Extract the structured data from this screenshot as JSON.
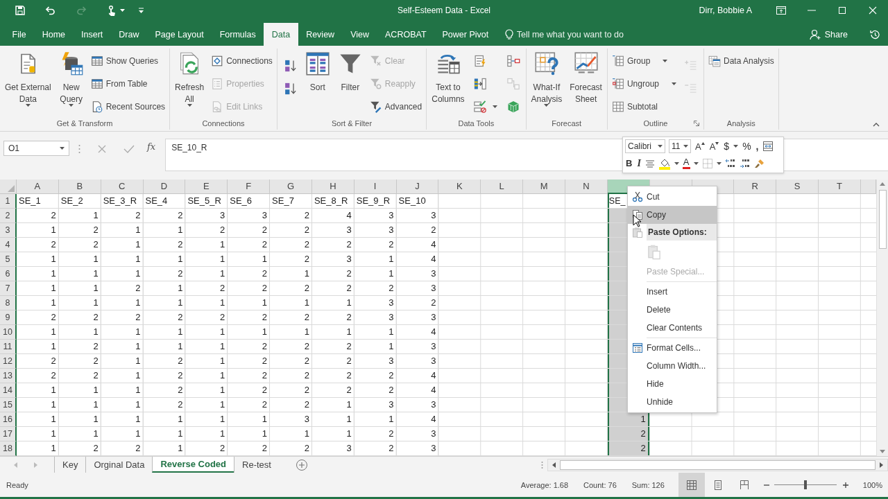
{
  "window": {
    "title": "Self-Esteem Data  -  Excel",
    "user": "Dirr, Bobbie A"
  },
  "ribbon_tabs": [
    {
      "label": "File",
      "selected": false
    },
    {
      "label": "Home",
      "selected": false
    },
    {
      "label": "Insert",
      "selected": false
    },
    {
      "label": "Draw",
      "selected": false
    },
    {
      "label": "Page Layout",
      "selected": false
    },
    {
      "label": "Formulas",
      "selected": false
    },
    {
      "label": "Data",
      "selected": true
    },
    {
      "label": "Review",
      "selected": false
    },
    {
      "label": "View",
      "selected": false
    },
    {
      "label": "ACROBAT",
      "selected": false
    },
    {
      "label": "Power Pivot",
      "selected": false
    }
  ],
  "tell_me": {
    "placeholder": "Tell me what you want to do"
  },
  "share": "Share",
  "ribbon_groups": [
    {
      "label": "Get & Transform",
      "launcher": false,
      "columns": [
        [
          {
            "kind": "large",
            "lines": [
              "Get External",
              "Data"
            ],
            "dropdown": true,
            "disabled": false
          }
        ],
        [
          {
            "kind": "large",
            "lines": [
              "New",
              "Query"
            ],
            "dropdown": true,
            "disabled": false
          }
        ],
        [
          {
            "kind": "small",
            "label": "Show Queries",
            "dropdown": false,
            "disabled": false
          },
          {
            "kind": "small",
            "label": "From Table",
            "dropdown": false,
            "disabled": false
          },
          {
            "kind": "small",
            "label": "Recent Sources",
            "dropdown": false,
            "disabled": false
          }
        ]
      ]
    },
    {
      "label": "Connections",
      "launcher": false,
      "columns": [
        [
          {
            "kind": "large",
            "lines": [
              "Refresh",
              "All"
            ],
            "dropdown": true,
            "disabled": false
          }
        ],
        [
          {
            "kind": "small",
            "label": "Connections",
            "dropdown": false,
            "disabled": false
          },
          {
            "kind": "small",
            "label": "Properties",
            "dropdown": false,
            "disabled": true
          },
          {
            "kind": "small",
            "label": "Edit Links",
            "dropdown": false,
            "disabled": true
          }
        ]
      ]
    },
    {
      "label": "Sort & Filter",
      "launcher": false,
      "columns": [
        [
          {
            "kind": "icon",
            "dropdown": false,
            "disabled": false
          },
          {
            "kind": "icon",
            "dropdown": false,
            "disabled": false
          }
        ],
        [
          {
            "kind": "large",
            "lines": [
              "Sort"
            ],
            "dropdown": false,
            "disabled": false
          }
        ],
        [
          {
            "kind": "large",
            "lines": [
              "Filter"
            ],
            "dropdown": false,
            "disabled": false
          }
        ],
        [
          {
            "kind": "small",
            "label": "Clear",
            "dropdown": false,
            "disabled": true
          },
          {
            "kind": "small",
            "label": "Reapply",
            "dropdown": false,
            "disabled": true
          },
          {
            "kind": "small",
            "label": "Advanced",
            "dropdown": false,
            "disabled": false
          }
        ]
      ]
    },
    {
      "label": "Data Tools",
      "launcher": false,
      "columns": [
        [
          {
            "kind": "large",
            "lines": [
              "Text to",
              "Columns"
            ],
            "dropdown": false,
            "disabled": false
          }
        ],
        [
          {
            "kind": "icon",
            "dropdown": false,
            "disabled": false
          },
          {
            "kind": "icon",
            "dropdown": false,
            "disabled": false
          },
          {
            "kind": "icon",
            "dropdown": true,
            "disabled": false
          }
        ],
        [
          {
            "kind": "icon",
            "dropdown": false,
            "disabled": false
          },
          {
            "kind": "icon",
            "dropdown": false,
            "disabled": true
          },
          {
            "kind": "icon",
            "dropdown": false,
            "disabled": false
          }
        ]
      ]
    },
    {
      "label": "Forecast",
      "launcher": false,
      "columns": [
        [
          {
            "kind": "large",
            "lines": [
              "What-If",
              "Analysis"
            ],
            "dropdown": true,
            "disabled": false
          }
        ],
        [
          {
            "kind": "large",
            "lines": [
              "Forecast",
              "Sheet"
            ],
            "dropdown": false,
            "disabled": false
          }
        ]
      ]
    },
    {
      "label": "Outline",
      "launcher": true,
      "columns": [
        [
          {
            "kind": "small",
            "label": "Group",
            "dropdown": true,
            "disabled": false
          },
          {
            "kind": "small",
            "label": "Ungroup",
            "dropdown": true,
            "disabled": false
          },
          {
            "kind": "small",
            "label": "Subtotal",
            "dropdown": false,
            "disabled": false
          }
        ],
        [
          {
            "kind": "icon",
            "dropdown": false,
            "disabled": true
          },
          {
            "kind": "icon",
            "dropdown": false,
            "disabled": true
          }
        ]
      ]
    },
    {
      "label": "Analysis",
      "launcher": false,
      "columns": [
        [
          {
            "kind": "small",
            "label": "Data Analysis",
            "dropdown": false,
            "disabled": false
          }
        ]
      ]
    }
  ],
  "formula_bar": {
    "name_box": "O1",
    "function_label": "fx",
    "formula": "SE_10_R"
  },
  "sheet": {
    "columns": [
      {
        "label": "A",
        "selected": false
      },
      {
        "label": "B",
        "selected": false
      },
      {
        "label": "C",
        "selected": false
      },
      {
        "label": "D",
        "selected": false
      },
      {
        "label": "E",
        "selected": false
      },
      {
        "label": "F",
        "selected": false
      },
      {
        "label": "G",
        "selected": false
      },
      {
        "label": "H",
        "selected": false
      },
      {
        "label": "I",
        "selected": false
      },
      {
        "label": "J",
        "selected": false
      },
      {
        "label": "K",
        "selected": false
      },
      {
        "label": "L",
        "selected": false
      },
      {
        "label": "M",
        "selected": false
      },
      {
        "label": "N",
        "selected": false
      },
      {
        "selected": true
      },
      {
        "selected": false
      },
      {
        "selected": false
      },
      {
        "label": "R",
        "selected": false
      },
      {
        "label": "S",
        "selected": false
      },
      {
        "label": "T",
        "selected": false
      }
    ],
    "rows": [
      {
        "label": "1",
        "kind": "text",
        "cells": [
          "SE_1",
          "SE_2",
          "SE_3_R",
          "SE_4",
          "SE_5_R",
          "SE_6",
          "SE_7",
          "SE_8_R",
          "SE_9_R",
          "SE_10"
        ],
        "selected_column_cell": "SE_"
      },
      {
        "label": "2",
        "kind": "number",
        "cells": [
          "2",
          "1",
          "2",
          "2",
          "3",
          "3",
          "2",
          "4",
          "3",
          "3"
        ]
      },
      {
        "label": "3",
        "kind": "number",
        "cells": [
          "1",
          "2",
          "1",
          "1",
          "2",
          "2",
          "2",
          "3",
          "3",
          "2"
        ]
      },
      {
        "label": "4",
        "kind": "number",
        "cells": [
          "2",
          "2",
          "1",
          "2",
          "1",
          "2",
          "2",
          "2",
          "2",
          "4"
        ]
      },
      {
        "label": "5",
        "kind": "number",
        "cells": [
          "1",
          "1",
          "1",
          "1",
          "1",
          "1",
          "2",
          "3",
          "1",
          "4"
        ]
      },
      {
        "label": "6",
        "kind": "number",
        "cells": [
          "1",
          "1",
          "1",
          "2",
          "1",
          "2",
          "1",
          "2",
          "1",
          "3"
        ]
      },
      {
        "label": "7",
        "kind": "number",
        "cells": [
          "1",
          "1",
          "2",
          "1",
          "2",
          "2",
          "2",
          "2",
          "2",
          "3"
        ]
      },
      {
        "label": "8",
        "kind": "number",
        "cells": [
          "1",
          "1",
          "1",
          "1",
          "1",
          "1",
          "1",
          "1",
          "3",
          "2"
        ]
      },
      {
        "label": "9",
        "kind": "number",
        "cells": [
          "2",
          "2",
          "2",
          "2",
          "2",
          "2",
          "2",
          "2",
          "3",
          "3"
        ]
      },
      {
        "label": "10",
        "kind": "number",
        "cells": [
          "1",
          "1",
          "1",
          "1",
          "1",
          "1",
          "1",
          "1",
          "1",
          "4"
        ]
      },
      {
        "label": "11",
        "kind": "number",
        "cells": [
          "1",
          "2",
          "1",
          "1",
          "1",
          "2",
          "2",
          "2",
          "1",
          "3"
        ]
      },
      {
        "label": "12",
        "kind": "number",
        "cells": [
          "2",
          "2",
          "1",
          "2",
          "1",
          "2",
          "2",
          "2",
          "3",
          "3"
        ]
      },
      {
        "label": "13",
        "kind": "number",
        "cells": [
          "2",
          "2",
          "1",
          "2",
          "1",
          "2",
          "2",
          "2",
          "2",
          "4"
        ]
      },
      {
        "label": "14",
        "kind": "number",
        "cells": [
          "1",
          "1",
          "1",
          "2",
          "1",
          "2",
          "2",
          "2",
          "2",
          "4"
        ]
      },
      {
        "label": "15",
        "kind": "number",
        "cells": [
          "1",
          "1",
          "1",
          "2",
          "1",
          "2",
          "2",
          "1",
          "3",
          "3"
        ]
      },
      {
        "label": "16",
        "kind": "number",
        "cells": [
          "1",
          "1",
          "1",
          "1",
          "1",
          "1",
          "3",
          "1",
          "1",
          "4"
        ],
        "selected_column_cell": "1"
      },
      {
        "label": "17",
        "kind": "number",
        "cells": [
          "1",
          "1",
          "1",
          "1",
          "1",
          "1",
          "1",
          "1",
          "2",
          "3"
        ],
        "selected_column_cell": "2"
      },
      {
        "label": "18",
        "kind": "number",
        "cells": [
          "1",
          "2",
          "2",
          "1",
          "2",
          "2",
          "2",
          "3",
          "2",
          "3"
        ],
        "selected_column_cell": "2"
      }
    ]
  },
  "mini_toolbar": {
    "font": "Calibri",
    "size": "11",
    "grow_font": "A",
    "shrink_font": "A",
    "currency": "$",
    "percent": "%",
    "comma": ",",
    "bold": "B",
    "italic": "I",
    "font_color": "A"
  },
  "context_menu": [
    {
      "kind": "item",
      "label": "Cut",
      "highlighted": false,
      "disabled": false
    },
    {
      "kind": "item",
      "label": "Copy",
      "highlighted": true,
      "disabled": false
    },
    {
      "kind": "heading",
      "label": "Paste Options:"
    },
    {
      "kind": "paste",
      "disabled": true
    },
    {
      "kind": "item",
      "label": "Paste Special...",
      "highlighted": false,
      "disabled": true
    },
    {
      "kind": "separator"
    },
    {
      "kind": "item",
      "label": "Insert",
      "highlighted": false,
      "disabled": false
    },
    {
      "kind": "item",
      "label": "Delete",
      "highlighted": false,
      "disabled": false
    },
    {
      "kind": "item",
      "label": "Clear Contents",
      "highlighted": false,
      "disabled": false
    },
    {
      "kind": "separator"
    },
    {
      "kind": "item",
      "label": "Format Cells...",
      "highlighted": false,
      "disabled": false
    },
    {
      "kind": "item",
      "label": "Column Width...",
      "highlighted": false,
      "disabled": false
    },
    {
      "kind": "item",
      "label": "Hide",
      "highlighted": false,
      "disabled": false
    },
    {
      "kind": "item",
      "label": "Unhide",
      "highlighted": false,
      "disabled": false
    }
  ],
  "sheet_tabs": [
    {
      "label": "Key",
      "selected": false
    },
    {
      "label": "Orginal Data",
      "selected": false
    },
    {
      "label": "Reverse Coded",
      "selected": true
    },
    {
      "label": "Re-test",
      "selected": false
    }
  ],
  "status_bar": {
    "state": "Ready",
    "stats": [
      "Average: 1.68",
      "Count: 76",
      "Sum: 126"
    ],
    "views": [
      {
        "selected": true
      },
      {
        "selected": false
      },
      {
        "selected": false
      }
    ],
    "zoom": {
      "level": 0.5,
      "label": "100%"
    }
  }
}
